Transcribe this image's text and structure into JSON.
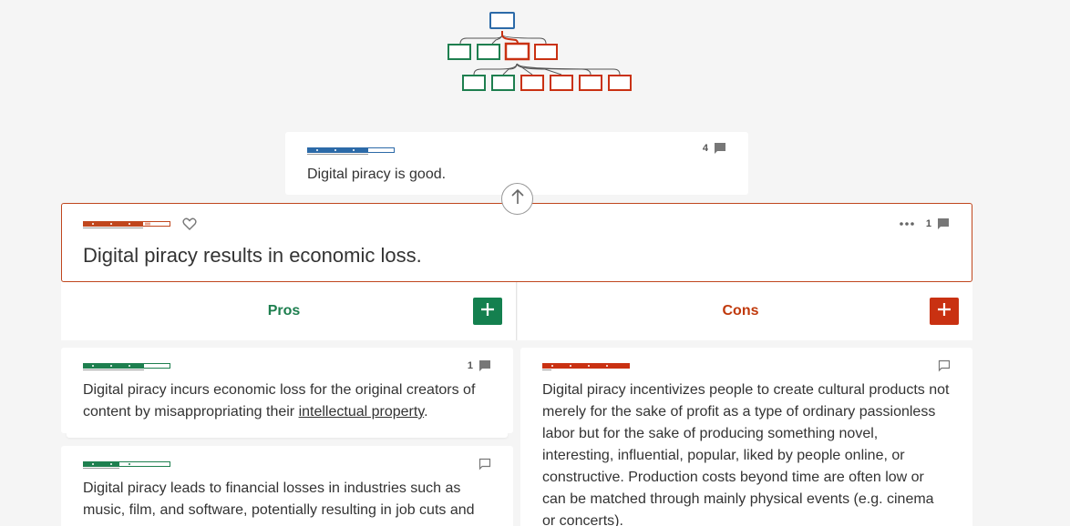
{
  "parent_claim": {
    "text": "Digital piracy is good.",
    "comment_count": "4",
    "accent": "#2c6aa8"
  },
  "main_claim": {
    "text": "Digital piracy results in economic loss.",
    "comment_count": "1",
    "accent": "#c0461d"
  },
  "columns": {
    "pros": {
      "label": "Pros",
      "color": "#1e7f4f"
    },
    "cons": {
      "label": "Cons",
      "color": "#c0390b"
    }
  },
  "pros": [
    {
      "text_before": "Digital piracy incurs economic loss for the original creators of content by misappropriating their ",
      "link": "intellectual property",
      "text_after": ".",
      "comment_count": "1"
    },
    {
      "text": "Digital piracy leads to financial losses in industries such as music, film, and software, potentially resulting in job cuts and",
      "comment_count": ""
    }
  ],
  "cons": [
    {
      "text": "Digital piracy incentivizes people to create cultural products not merely for the sake of profit as a type of ordinary passionless labor but for the sake of producing something novel, interesting, influential, popular, liked by people online, or constructive. Production costs beyond time are often low or can be matched through mainly physical events (e.g. cinema or concerts).",
      "comment_count": ""
    }
  ],
  "icons": {
    "comment": "comment-icon",
    "heart": "heart-icon",
    "menu": "more-dots-icon",
    "add": "plus-icon",
    "up": "arrow-up-icon"
  }
}
